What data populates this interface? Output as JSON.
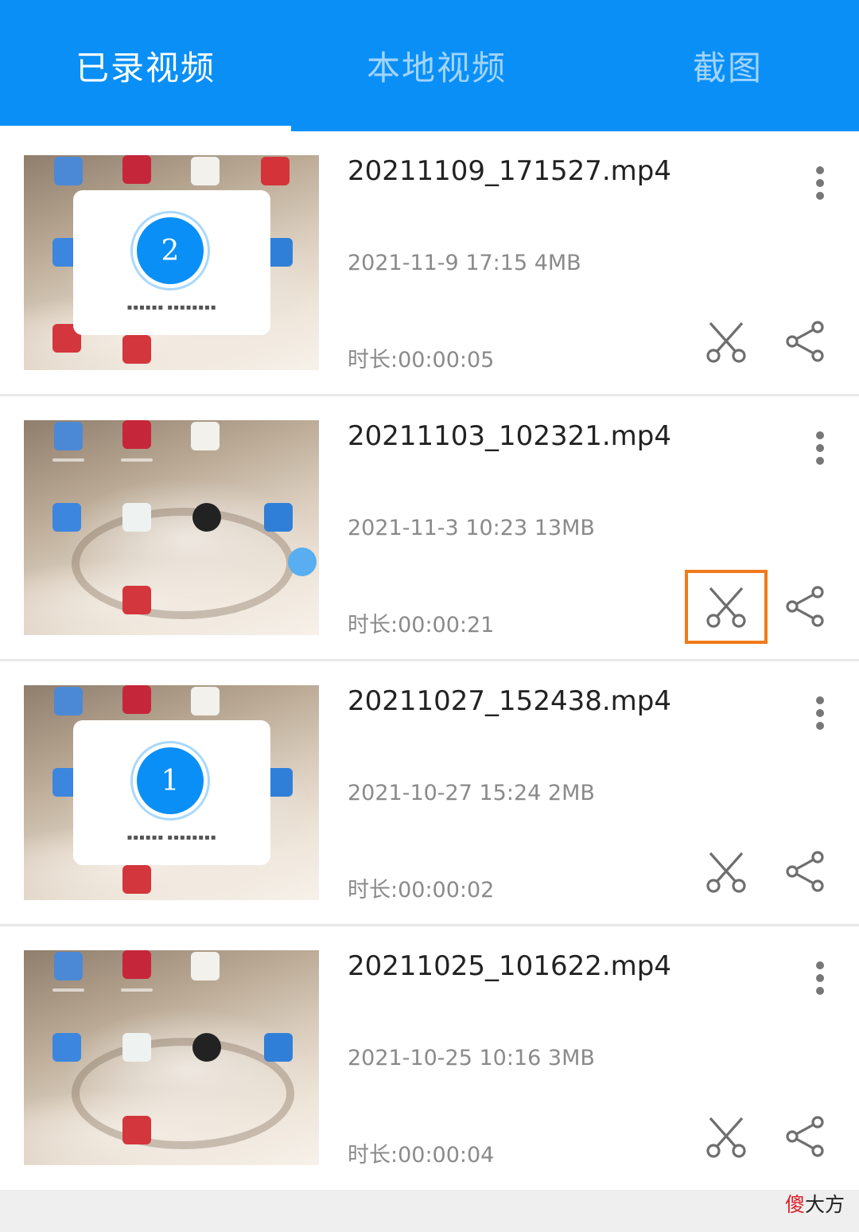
{
  "tabs": [
    {
      "label": "已录视频",
      "active": true
    },
    {
      "label": "本地视频",
      "active": false
    },
    {
      "label": "截图",
      "active": false
    }
  ],
  "videos": [
    {
      "filename": "20211109_171527.mp4",
      "meta": "2021-11-9 17:15 4MB",
      "duration": "时长:00:00:05",
      "thumbnail": "countdown",
      "countdown_number": "2"
    },
    {
      "filename": "20211103_102321.mp4",
      "meta": "2021-11-3 10:23 13MB",
      "duration": "时长:00:00:21",
      "thumbnail": "home-screen",
      "cut_highlighted": true
    },
    {
      "filename": "20211027_152438.mp4",
      "meta": "2021-10-27 15:24 2MB",
      "duration": "时长:00:00:02",
      "thumbnail": "countdown",
      "countdown_number": "1"
    },
    {
      "filename": "20211025_101622.mp4",
      "meta": "2021-10-25 10:16 3MB",
      "duration": "时长:00:00:04",
      "thumbnail": "home-screen"
    }
  ],
  "icons": {
    "more": "more-vertical-icon",
    "cut": "scissors-icon",
    "share": "share-icon"
  },
  "colors": {
    "accent": "#0a8ff7",
    "highlight": "#f07a1a",
    "text_primary": "#222222",
    "text_secondary": "#8a8a8a"
  },
  "watermark": {
    "text_red": "傻",
    "text_dark": "大方"
  }
}
